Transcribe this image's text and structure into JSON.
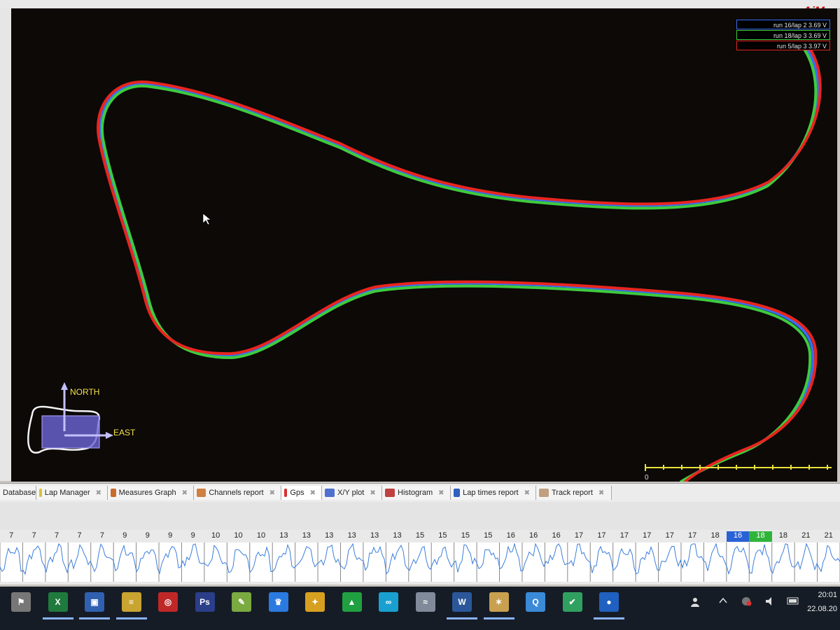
{
  "app": {
    "logo_text": "AiM"
  },
  "legend": [
    {
      "text": "run 16/lap 2 3.69 V",
      "color": "#3a6ef0"
    },
    {
      "text": "run 18/lap 3 3.69 V",
      "color": "#3ecb3e"
    },
    {
      "text": "run 5/lap 3 3.97 V",
      "color": "#e8251e"
    }
  ],
  "compass": {
    "north": "NORTH",
    "east": "EAST"
  },
  "scale": {
    "zero": "0"
  },
  "tabs": [
    {
      "label": "Database",
      "icon": "database-icon",
      "icon_color": "#8a8a8a"
    },
    {
      "label": "Lap Manager",
      "icon": "lap-manager-icon",
      "icon_color": "#d6c23a"
    },
    {
      "label": "Measures Graph",
      "icon": "measures-graph-icon",
      "icon_color": "#c96b2d"
    },
    {
      "label": "Channels report",
      "icon": "channels-report-icon",
      "icon_color": "#d08040"
    },
    {
      "label": "Gps",
      "icon": "gps-icon",
      "icon_color": "#d83030",
      "active": true
    },
    {
      "label": "X/Y plot",
      "icon": "xy-plot-icon",
      "icon_color": "#5070d0"
    },
    {
      "label": "Histogram",
      "icon": "histogram-icon",
      "icon_color": "#c04040"
    },
    {
      "label": "Lap times report",
      "icon": "lap-times-icon",
      "icon_color": "#3060c0"
    },
    {
      "label": "Track report",
      "icon": "track-report-icon",
      "icon_color": "#c0a080"
    }
  ],
  "lap_strip": [
    "7",
    "7",
    "7",
    "7",
    "7",
    "9",
    "9",
    "9",
    "9",
    "10",
    "10",
    "10",
    "13",
    "13",
    "13",
    "13",
    "13",
    "13",
    "15",
    "15",
    "15",
    "15",
    "16",
    "16",
    "16",
    "17",
    "17",
    "17",
    "17",
    "17",
    "17",
    "18",
    "16",
    "18",
    "18",
    "21",
    "21"
  ],
  "taskbar": {
    "apps": [
      "start-flag-icon",
      "excel-icon",
      "save-icon",
      "database-tool-icon",
      "race-studio-icon",
      "photoshop-icon",
      "app-icon",
      "crown-icon",
      "puzzle-icon",
      "pyramid-icon",
      "arduino-icon",
      "graph-app-icon",
      "word-icon",
      "image-app-icon",
      "browser-icon",
      "map-app-icon",
      "globe-icon"
    ],
    "time": "20:01",
    "date": "22.08.20"
  }
}
